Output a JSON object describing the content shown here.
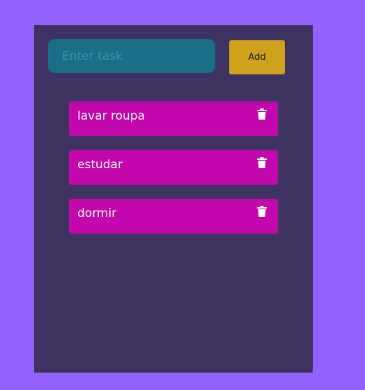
{
  "colors": {
    "page_background": "#9163fc",
    "panel_background": "#3e3360",
    "input_background": "#1a6f87",
    "add_button_background": "#cfa019",
    "task_background": "#c208ac",
    "task_text": "#ffffff"
  },
  "form": {
    "input_placeholder": "Enter task",
    "input_value": "",
    "add_label": "Add"
  },
  "tasks": [
    {
      "label": "lavar roupa",
      "icon": "trash-icon"
    },
    {
      "label": "estudar",
      "icon": "trash-icon"
    },
    {
      "label": "dormir",
      "icon": "trash-icon"
    }
  ]
}
